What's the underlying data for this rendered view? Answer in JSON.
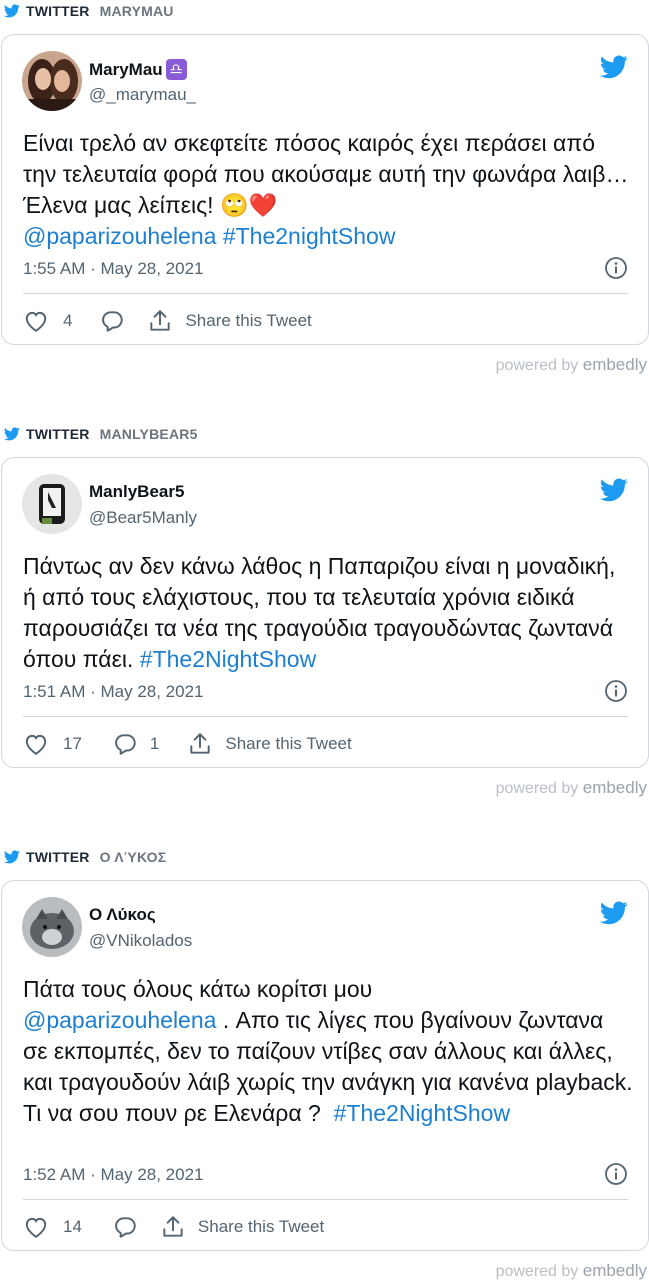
{
  "source_label": "TWITTER",
  "powered_by": "powered by",
  "powered_brand": "embedly",
  "share_label": "Share this Tweet",
  "colors": {
    "link": "#1d7fcf",
    "twitter_blue": "#1d9bf0",
    "muted": "#536471",
    "border": "#cfd9de"
  },
  "embeds": [
    {
      "author_label": "MARYMAU",
      "name": "MaryMau",
      "badge": "♎",
      "handle": "@_marymau_",
      "text_plain": "Είναι τρελό αν σκεφτείτε πόσος καιρός έχει περάσει από την τελευταία φορά που ακούσαμε αυτή την φωνάρα λαιβ… Έλενα μας λείπεις! 🙄❤️\n",
      "mention": "@paparizouhelena",
      "hashtag": "#The2nightShow",
      "timestamp": "1:55 AM · May 28, 2021",
      "likes": "4",
      "replies": ""
    },
    {
      "author_label": "MANLYBEAR5",
      "name": "ManlyBear5",
      "handle": "@Bear5Manly",
      "text_plain": "Πάντως αν δεν κάνω λάθος η Παπαριζου είναι η μοναδική, ή από τους ελάχιστους, που τα τελευταία χρόνια ειδικά παρουσιάζει τα νέα της τραγούδια τραγουδώντας ζωντανά όπου πάει. ",
      "hashtag": "#The2NightShow",
      "timestamp": "1:51 AM · May 28, 2021",
      "likes": "17",
      "replies": "1"
    },
    {
      "author_label": "Ο ΛΎΚΟΣ",
      "name": "Ο Λύκος",
      "handle": "@VNikolados",
      "text_before": "Πάτα τους όλους κάτω κορίτσι μου\n",
      "mention": "@paparizouhelena",
      "text_after": " . Απο τις λίγες που βγαίνουν ζωντανα σε εκπομπές, δεν το παίζουν ντίβες σαν άλλους και άλλες, και τραγουδούν λάιβ χωρίς την ανάγκη για κανένα playback. Τι να σου πουν ρε Ελενάρα ?  ",
      "hashtag": "#The2NightShow",
      "timestamp": "1:52 AM · May 28, 2021",
      "likes": "14",
      "replies": ""
    }
  ]
}
